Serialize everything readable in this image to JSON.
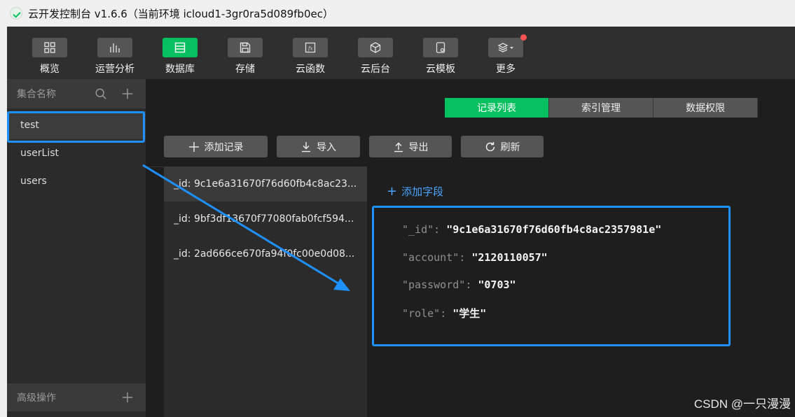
{
  "window": {
    "title": "云开发控制台 v1.6.6（当前环境 icloud1-3gr0ra5d089fb0ec）"
  },
  "toolbar": {
    "items": [
      {
        "label": "概览",
        "icon": "grid-icon"
      },
      {
        "label": "运营分析",
        "icon": "bar-chart-icon"
      },
      {
        "label": "数据库",
        "icon": "database-icon"
      },
      {
        "label": "存储",
        "icon": "save-icon"
      },
      {
        "label": "云函数",
        "icon": "function-icon"
      },
      {
        "label": "云后台",
        "icon": "cube-icon"
      },
      {
        "label": "云模板",
        "icon": "template-icon"
      },
      {
        "label": "更多",
        "icon": "layers-icon"
      }
    ],
    "active_index": 2,
    "accent_color": "#07c160"
  },
  "sidebar": {
    "title": "集合名称",
    "collections": [
      "test",
      "userList",
      "users"
    ],
    "active_collection": "test",
    "footer_title": "高级操作"
  },
  "tabs": {
    "items": [
      "记录列表",
      "索引管理",
      "数据权限"
    ],
    "active_index": 0
  },
  "actions": {
    "add_record": "添加记录",
    "import": "导入",
    "export": "导出",
    "refresh": "刷新"
  },
  "records": [
    "_id: 9c1e6a31670f76d60fb4c8ac23...",
    "_id: 9bf3df13670f77080fab0fcf594...",
    "_id: 2ad666ce670fa94f0fc00e0d08..."
  ],
  "detail": {
    "add_field": "添加字段",
    "fields": [
      {
        "key": "\"_id\"",
        "value": "\"9c1e6a31670f76d60fb4c8ac2357981e\""
      },
      {
        "key": "\"account\"",
        "value": "\"2120110057\""
      },
      {
        "key": "\"password\"",
        "value": "\"0703\""
      },
      {
        "key": "\"role\"",
        "value": "\"学生\""
      }
    ]
  },
  "highlight_color": "#1e90ff",
  "watermark": "CSDN @一只漫漫"
}
